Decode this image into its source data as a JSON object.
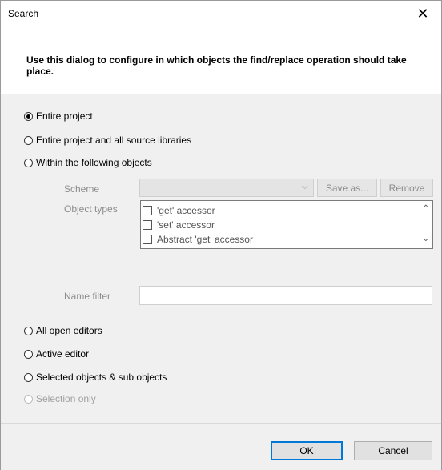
{
  "window": {
    "title": "Search",
    "close_glyph": "✕"
  },
  "header": {
    "text": "Use this dialog to configure in which objects the find/replace operation should take place."
  },
  "options": {
    "entire_project": "Entire project",
    "entire_project_libs": "Entire project and all source libraries",
    "within_objects": "Within the following objects",
    "all_open_editors": "All open editors",
    "active_editor": "Active editor",
    "selected_objects": "Selected objects & sub objects",
    "selection_only": "Selection only"
  },
  "within": {
    "scheme_label": "Scheme",
    "save_as": "Save as...",
    "remove": "Remove",
    "object_types_label": "Object types",
    "object_types": [
      "'get' accessor",
      "'set' accessor",
      "Abstract 'get' accessor"
    ],
    "name_filter_label": "Name filter"
  },
  "buttons": {
    "ok": "OK",
    "cancel": "Cancel"
  },
  "icons": {
    "scroll_up": "chevron-up-icon",
    "scroll_down": "chevron-down-icon",
    "combo_arrow": "chevron-down-icon"
  }
}
